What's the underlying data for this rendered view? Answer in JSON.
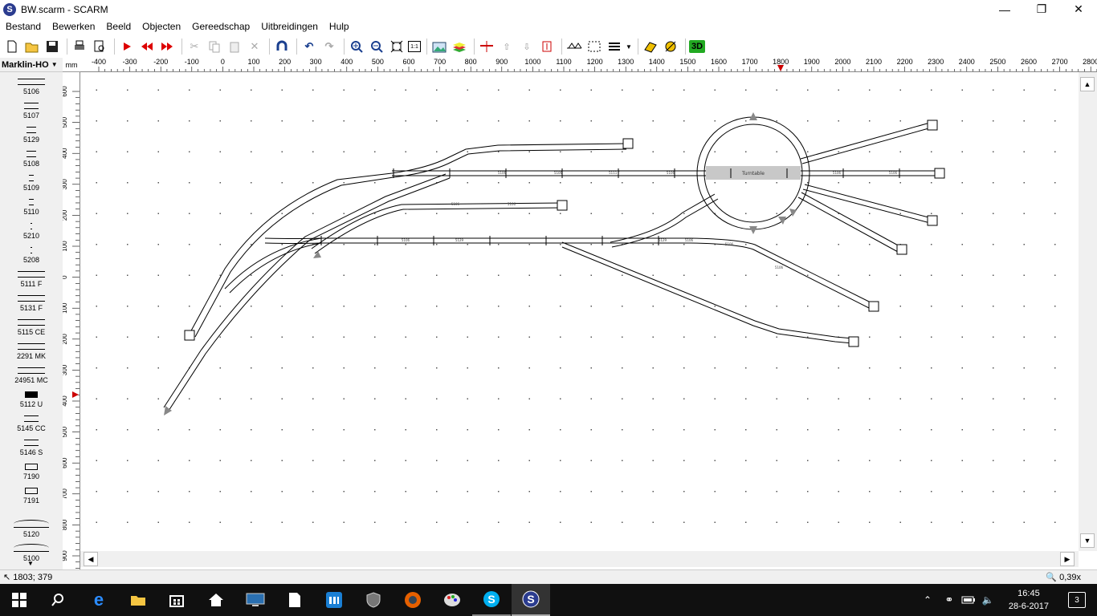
{
  "window": {
    "title": "BW.scarm - SCARM",
    "app_icon": "S"
  },
  "menu": [
    "Bestand",
    "Bewerken",
    "Beeld",
    "Objecten",
    "Gereedschap",
    "Uitbreidingen",
    "Hulp"
  ],
  "toolbar": {
    "icons": [
      "new-icon",
      "open-icon",
      "save-icon",
      "print-icon",
      "print-preview-icon",
      "play-icon",
      "rewind-icon",
      "forward-icon",
      "cut-icon",
      "copy-icon",
      "paste-icon",
      "delete-icon",
      "rotate-icon",
      "undo-icon",
      "redo-icon",
      "zoom-in-icon",
      "zoom-out-icon",
      "zoom-fit-icon",
      "zoom-1to1-icon",
      "background-image-icon",
      "layers-icon",
      "track-height-icon",
      "flex-track-icon",
      "gradient-icon",
      "label-icon",
      "bridge-icon",
      "tunnel-icon",
      "list-icon",
      "dropdown-icon",
      "measure-icon",
      "ruler-icon",
      "3d-view-icon"
    ],
    "zoom_1to1_label": "1:1",
    "view_3d_label": "3D"
  },
  "library": {
    "selector": "Marklin-HO",
    "unit": "mm",
    "items": [
      {
        "label": "5106",
        "shape": "straight-long"
      },
      {
        "label": "5107",
        "shape": "straight-medium"
      },
      {
        "label": "5129",
        "shape": "straight-short"
      },
      {
        "label": "5108",
        "shape": "straight-short"
      },
      {
        "label": "5109",
        "shape": "straight-tiny"
      },
      {
        "label": "5110",
        "shape": "straight-tiny"
      },
      {
        "label": "5210",
        "shape": "straight-micro"
      },
      {
        "label": "5208",
        "shape": "straight-micro"
      },
      {
        "label": "5111 F",
        "shape": "straight-long"
      },
      {
        "label": "5131 F",
        "shape": "straight-long"
      },
      {
        "label": "5115 CE",
        "shape": "straight-long"
      },
      {
        "label": "2291 MK",
        "shape": "straight-long"
      },
      {
        "label": "24951 MC",
        "shape": "straight-long"
      },
      {
        "label": "5112 U",
        "shape": "uncoupler"
      },
      {
        "label": "5145 CC",
        "shape": "straight-medium"
      },
      {
        "label": "5146 S",
        "shape": "straight-medium"
      },
      {
        "label": "7190",
        "shape": "buffer"
      },
      {
        "label": "7191",
        "shape": "buffer"
      },
      {
        "label": "5120",
        "shape": "curve"
      },
      {
        "label": "5100",
        "shape": "curve"
      }
    ]
  },
  "rulers": {
    "horizontal_labels": [
      "-400",
      "-300",
      "-200",
      "-100",
      "0",
      "100",
      "200",
      "300",
      "400",
      "500",
      "600",
      "700",
      "800",
      "900",
      "1000",
      "1100",
      "1200",
      "1300",
      "1400",
      "1500",
      "1600",
      "1700",
      "1800",
      "1900",
      "2000",
      "2100",
      "2200",
      "2300",
      "2400",
      "2500",
      "2600",
      "2700",
      "2800"
    ],
    "vertical_labels": [
      "600",
      "500",
      "400",
      "300",
      "200",
      "100",
      "0",
      "100",
      "200",
      "300",
      "400",
      "500",
      "600",
      "700",
      "800",
      "900"
    ]
  },
  "layout": {
    "turntable_label": "Turntable",
    "track_labels": [
      "5106",
      "5106",
      "5111 F",
      "5106",
      "5106",
      "5106",
      "5106",
      "5106",
      "5106",
      "5129",
      "5129",
      "5106",
      "5106",
      "5106"
    ]
  },
  "status": {
    "coords": "1803; 379",
    "zoom": "0,39x"
  },
  "taskbar": {
    "apps": [
      "start-icon",
      "search-icon",
      "edge-icon",
      "file-explorer-icon",
      "store-icon",
      "home-icon",
      "monitor-icon",
      "document-icon",
      "maxthon-icon",
      "shield-icon",
      "firefox-icon",
      "paint-icon",
      "skype-icon",
      "scarm-icon"
    ],
    "time": "16:45",
    "date": "28-6-2017",
    "notifications": "3"
  }
}
